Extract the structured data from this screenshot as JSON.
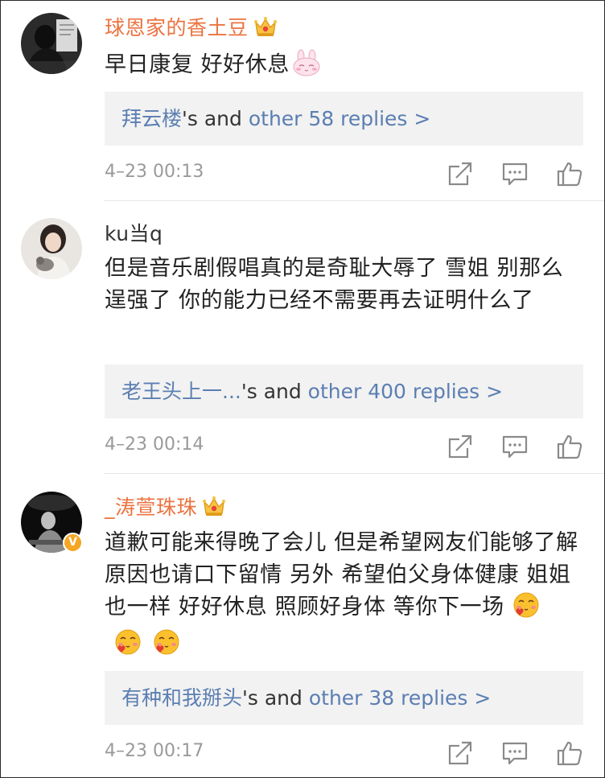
{
  "comments": [
    {
      "username": "球恩家的香土豆",
      "text": "早日康复 好好休息",
      "reply_prefix": "拜云楼",
      "reply_mid": "'s and ",
      "reply_more": "other 58 replies >",
      "time": "4–23 00:13"
    },
    {
      "username": "ku当q",
      "text": "但是音乐剧假唱真的是奇耻大辱了 雪姐 别那么逞强了 你的能力已经不需要再去证明什么了",
      "reply_prefix": "老王头上一...",
      "reply_mid": "'s and ",
      "reply_more": "other 400 replies >",
      "time": "4–23 00:14"
    },
    {
      "username": "_涛萱珠珠",
      "text": "道歉可能来得晚了会儿 但是希望网友们能够了解原因也请口下留情 另外 希望伯父身体健康 姐姐也一样 好好休息 照顾好身体 等你下一场",
      "reply_prefix": "有种和我掰头",
      "reply_mid": "'s and ",
      "reply_more": "other 38 replies >",
      "time": "4–23 00:17",
      "verified_mark": "V"
    }
  ],
  "colors": {
    "vip_name": "#eb7340",
    "link_blue": "#5b7eb2",
    "reply_bg": "#f2f2f2",
    "timestamp": "#9a9a9a",
    "icon": "#8a8a8a",
    "verified": "#f5a623"
  },
  "icons": {
    "crown": "crown-vip-icon",
    "share": "share-icon",
    "comment": "comment-icon",
    "like": "thumbs-up-icon",
    "bunny": "bunny-emoji-icon",
    "blush": "blush-heart-emoji-icon"
  }
}
